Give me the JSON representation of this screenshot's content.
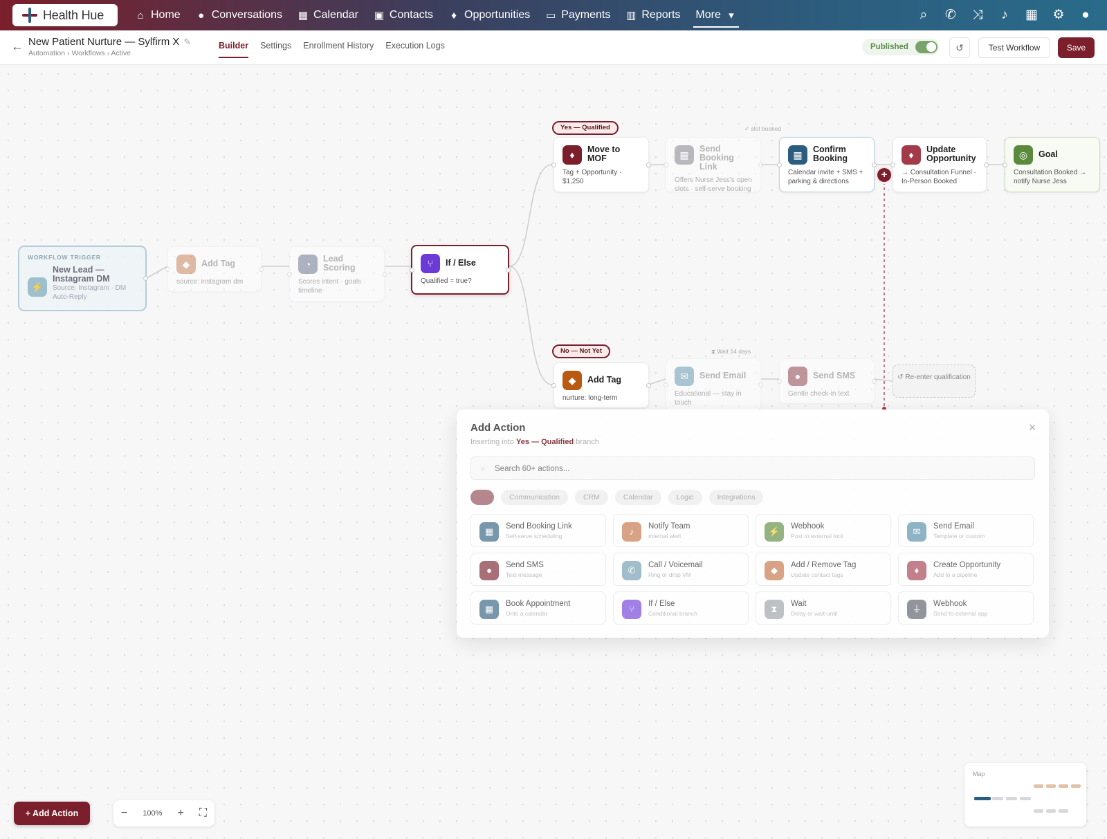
{
  "nav": {
    "brand": "Health Hue",
    "items": [
      {
        "label": "Home",
        "icon": "home-icon",
        "glyph": "⌂"
      },
      {
        "label": "Conversations",
        "icon": "chat-icon",
        "glyph": "●"
      },
      {
        "label": "Calendar",
        "icon": "calendar-icon",
        "glyph": "▦"
      },
      {
        "label": "Contacts",
        "icon": "contacts-icon",
        "glyph": "▣"
      },
      {
        "label": "Opportunities",
        "icon": "lightbulb-icon",
        "glyph": "♦"
      },
      {
        "label": "Payments",
        "icon": "card-icon",
        "glyph": "▭"
      },
      {
        "label": "Reports",
        "icon": "chart-icon",
        "glyph": "▥"
      },
      {
        "label": "More",
        "icon": "chevron-down-icon",
        "glyph": "▾"
      }
    ],
    "right_icons": [
      "search-icon",
      "phone-icon",
      "shuffle-icon",
      "bell-icon",
      "calendar-icon",
      "gear-icon",
      "user-icon"
    ]
  },
  "header": {
    "title": "New Patient Nurture — Sylfirm X",
    "breadcrumb": "Automation › Workflows › Active",
    "tabs": [
      "Builder",
      "Settings",
      "Enrollment History",
      "Execution Logs"
    ],
    "active_tab": "Builder",
    "published_label": "Published",
    "published": true,
    "test_label": "Test Workflow",
    "save_label": "Save"
  },
  "colors": {
    "brand": "#7a1f2b",
    "accent_blue": "#2c5d7e",
    "goal_green": "#5b8a3c"
  },
  "canvas": {
    "trigger": {
      "label": "WORKFLOW TRIGGER",
      "title": "New Lead — Instagram DM",
      "sub": "Source: Instagram · DM Auto-Reply"
    },
    "add_tag": {
      "title": "Add Tag",
      "sub": "source: instagram dm"
    },
    "lead_scoring": {
      "title": "Lead Scoring",
      "sub": "Scores intent · goals · timeline"
    },
    "if_else": {
      "title": "If / Else",
      "sub": "Qualified = true?"
    },
    "yes_branch": {
      "label": "Yes — Qualified",
      "note": "✓ slot booked"
    },
    "move_mof": {
      "title": "Move to MOF",
      "sub": "Tag + Opportunity · $1,250"
    },
    "send_booking": {
      "title": "Send Booking Link",
      "sub": "Offers Nurse Jess's open slots · self-serve booking"
    },
    "confirm_booking": {
      "title": "Confirm Booking",
      "sub": "Calendar invite + SMS + parking & directions"
    },
    "update_opp": {
      "title": "Update Opportunity",
      "sub": "→ Consultation Funnel · In-Person Booked"
    },
    "goal": {
      "title": "Goal",
      "sub": "Consultation Booked → notify Nurse Jess"
    },
    "no_branch": {
      "label": "No — Not Yet",
      "note": "⧗ Wait 14 days"
    },
    "add_tag_no": {
      "title": "Add Tag",
      "sub": "nurture: long-term"
    },
    "send_email": {
      "title": "Send Email",
      "sub": "Educational — stay in touch"
    },
    "send_sms": {
      "title": "Send SMS",
      "sub": "Gentle check-in text"
    },
    "reenter": "↺ Re-enter qualification",
    "plus": "+"
  },
  "modal": {
    "title": "Add Action",
    "sub_prefix": "Inserting into",
    "sub_branch": "Yes — Qualified",
    "sub_suffix": "branch",
    "search_placeholder": "Search 60+ actions...",
    "chips": [
      "Communication",
      "CRM",
      "Calendar",
      "Logic",
      "Integrations"
    ],
    "actions": [
      {
        "title": "Send Booking Link",
        "sub": "Self-serve scheduling",
        "icon": "calendar-icon",
        "color": "#2c5d7e",
        "glyph": "▦"
      },
      {
        "title": "Notify Team",
        "sub": "Internal alert",
        "icon": "bell-icon",
        "color": "#c2703f",
        "glyph": "♪"
      },
      {
        "title": "Webhook",
        "sub": "Post to external tool",
        "icon": "bolt-icon",
        "color": "#5b8a3c",
        "glyph": "⚡"
      },
      {
        "title": "Send Email",
        "sub": "Template or custom",
        "icon": "mail-icon",
        "color": "#4f8aa6",
        "glyph": "✉"
      },
      {
        "title": "Send SMS",
        "sub": "Text message",
        "icon": "chat-icon",
        "color": "#7a1f2b",
        "glyph": "●"
      },
      {
        "title": "Call / Voicemail",
        "sub": "Ring or drop VM",
        "icon": "phone-icon",
        "color": "#6d9ab0",
        "glyph": "✆"
      },
      {
        "title": "Add / Remove Tag",
        "sub": "Update contact tags",
        "icon": "tag-icon",
        "color": "#c2703f",
        "glyph": "◆"
      },
      {
        "title": "Create Opportunity",
        "sub": "Add to a pipeline",
        "icon": "lightbulb-icon",
        "color": "#a33a4a",
        "glyph": "♦"
      },
      {
        "title": "Book Appointment",
        "sub": "Onto a calendar",
        "icon": "calendar-icon",
        "color": "#2c5d7e",
        "glyph": "▦"
      },
      {
        "title": "If / Else",
        "sub": "Conditional branch",
        "icon": "branch-icon",
        "color": "#6c3ad6",
        "glyph": "⑂"
      },
      {
        "title": "Wait",
        "sub": "Delay or wait-until",
        "icon": "hourglass-icon",
        "color": "#9aa0a6",
        "glyph": "⧗"
      },
      {
        "title": "Webhook",
        "sub": "Send to external app",
        "icon": "plug-icon",
        "color": "#555b63",
        "glyph": "⏚"
      }
    ]
  },
  "bottom": {
    "add_action": "+ Add Action",
    "zoom_out": "−",
    "zoom": "100%",
    "zoom_in": "+",
    "fit": "⛶",
    "map_label": "Map"
  }
}
